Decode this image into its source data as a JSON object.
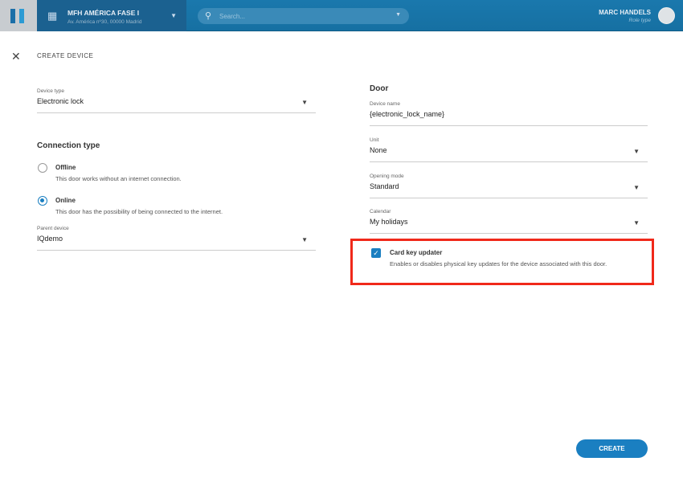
{
  "header": {
    "site_name": "MFH AMÉRICA FASE I",
    "site_address": "Av. América nº30, 00000 Madrid",
    "search_placeholder": "Search...",
    "user_name": "MARC HANDELS",
    "user_role": "Role type"
  },
  "page": {
    "title": "CREATE DEVICE",
    "create_label": "CREATE"
  },
  "left": {
    "device_type": {
      "label": "Device type",
      "value": "Electronic lock"
    },
    "connection_title": "Connection type",
    "options": [
      {
        "title": "Offline",
        "desc": "This door works without an internet connection.",
        "selected": false
      },
      {
        "title": "Online",
        "desc": "This door has the possibility of being connected to the internet.",
        "selected": true
      }
    ],
    "parent_device": {
      "label": "Parent device",
      "value": "IQdemo"
    }
  },
  "right": {
    "title": "Door",
    "device_name": {
      "label": "Device name",
      "value": "{electronic_lock_name}"
    },
    "unit": {
      "label": "Unit",
      "value": "None"
    },
    "opening_mode": {
      "label": "Opening mode",
      "value": "Standard"
    },
    "calendar": {
      "label": "Calendar",
      "value": "My holidays"
    },
    "card_key": {
      "title": "Card key updater",
      "desc": "Enables or disables physical key updates for the device associated with this door.",
      "checked": true
    }
  },
  "colors": {
    "accent": "#1a7fc1",
    "header": "#1670a2",
    "highlight": "#f0291a"
  }
}
